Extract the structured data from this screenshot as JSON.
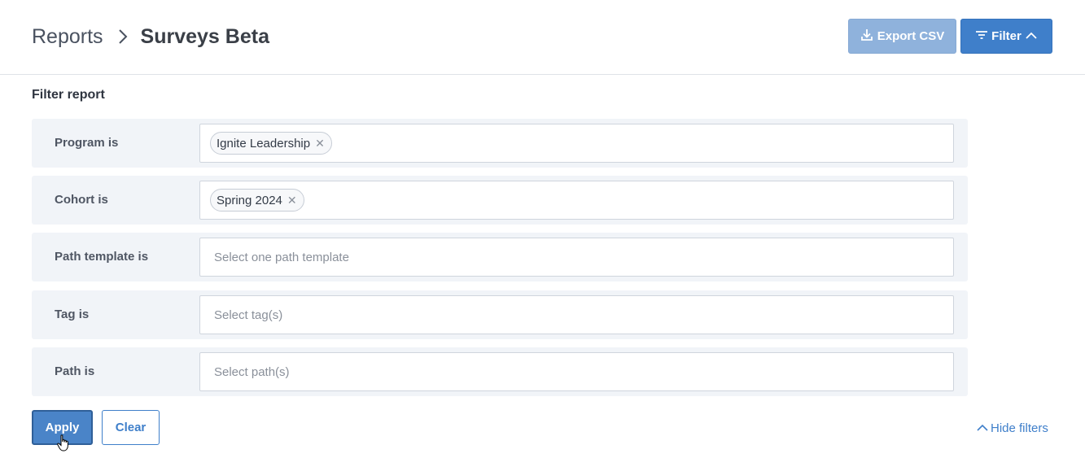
{
  "breadcrumb": {
    "parent": "Reports",
    "current": "Surveys Beta"
  },
  "toolbar": {
    "export_label": "Export CSV",
    "filter_label": "Filter"
  },
  "filter_panel": {
    "title": "Filter report",
    "rows": [
      {
        "label": "Program is",
        "tags": [
          "Ignite Leadership"
        ],
        "placeholder": ""
      },
      {
        "label": "Cohort is",
        "tags": [
          "Spring 2024"
        ],
        "placeholder": ""
      },
      {
        "label": "Path template is",
        "tags": [],
        "placeholder": "Select one path template"
      },
      {
        "label": "Tag is",
        "tags": [],
        "placeholder": "Select tag(s)"
      },
      {
        "label": "Path is",
        "tags": [],
        "placeholder": "Select path(s)"
      }
    ],
    "apply_label": "Apply",
    "clear_label": "Clear",
    "hide_filters_label": "Hide filters"
  },
  "colors": {
    "primary": "#3f7fca",
    "primary_disabled": "#8fb2dc",
    "row_background": "#f1f4f8"
  },
  "icons": {
    "breadcrumb_separator": "chevron-right-icon",
    "export": "download-icon",
    "filter": "filter-icon",
    "filter_toggle": "chevron-up-icon",
    "tag_remove": "close-icon",
    "hide_filters": "chevron-up-icon",
    "cursor": "hand-pointer-cursor-icon"
  }
}
